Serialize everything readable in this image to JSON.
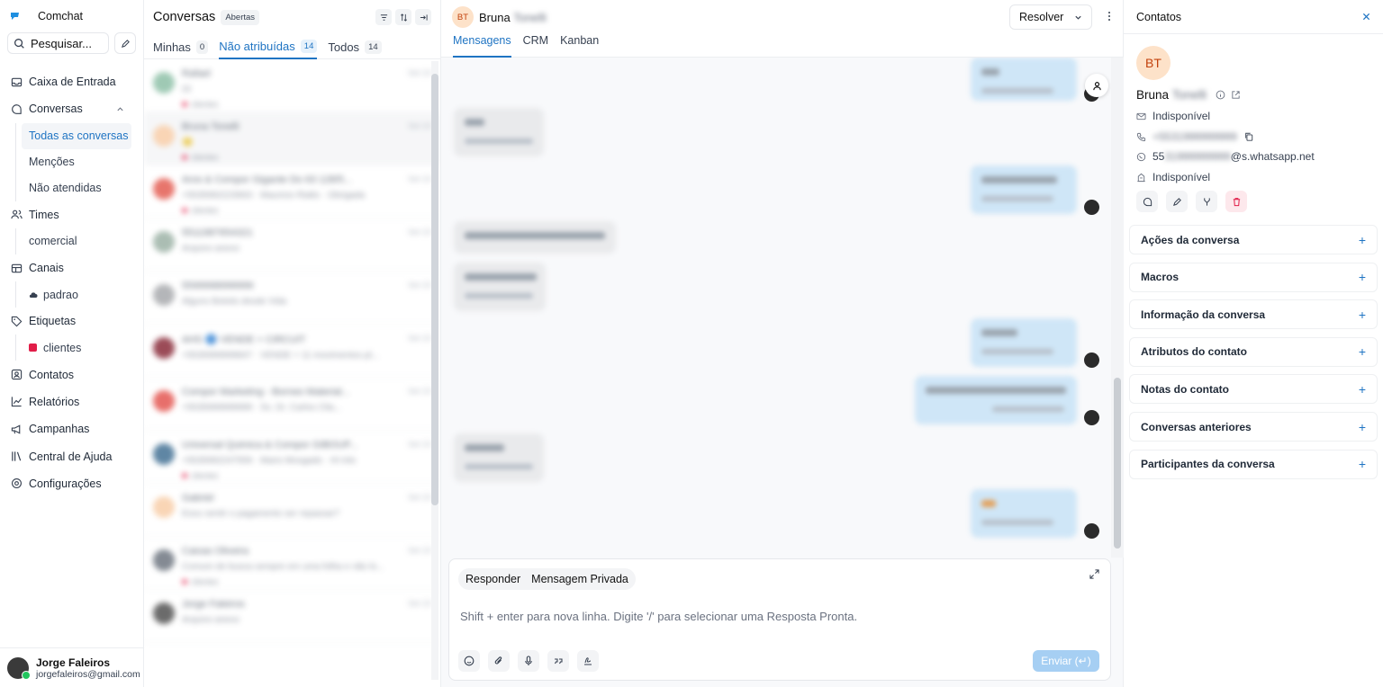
{
  "app": {
    "name": "Comchat"
  },
  "sidebar": {
    "search_label": "Pesquisar...",
    "items": [
      {
        "label": "Caixa de Entrada",
        "icon": "inbox-icon"
      },
      {
        "label": "Conversas",
        "icon": "chat-icon"
      },
      {
        "label": "Times",
        "icon": "users-icon"
      },
      {
        "label": "Canais",
        "icon": "channels-icon"
      },
      {
        "label": "Etiquetas",
        "icon": "tag-icon"
      },
      {
        "label": "Contatos",
        "icon": "contact-icon"
      },
      {
        "label": "Relatórios",
        "icon": "chart-icon"
      },
      {
        "label": "Campanhas",
        "icon": "megaphone-icon"
      },
      {
        "label": "Central de Ajuda",
        "icon": "library-icon"
      },
      {
        "label": "Configurações",
        "icon": "settings-icon"
      }
    ],
    "conversas_sub": [
      "Todas as conversas",
      "Menções",
      "Não atendidas"
    ],
    "times_sub": [
      "comercial"
    ],
    "canais_sub": [
      "padrao"
    ],
    "etiquetas_sub": [
      "clientes"
    ],
    "user": {
      "name": "Jorge Faleiros",
      "email": "jorgefaleiros@gmail.com"
    }
  },
  "conversations": {
    "title": "Conversas",
    "status_badge": "Abertas",
    "tabs": [
      {
        "label": "Minhas",
        "count": "0"
      },
      {
        "label": "Não atribuídas",
        "count": "14"
      },
      {
        "label": "Todos",
        "count": "14"
      }
    ],
    "items": [
      {
        "name": "Rafael",
        "preview": "Oi",
        "time": "Set 10",
        "label": "clientes",
        "color": "#7fb89c"
      },
      {
        "name": "Bruna Tonelli",
        "preview": "🙂",
        "time": "Set 10",
        "label": "clientes",
        "color": "#f7c79d"
      },
      {
        "name": "Aros & Compor Gigante Do 63 128/5...",
        "preview": "+5535992223663 · Mauricio Rialto · Obrigada",
        "time": "Set 10",
        "label": "clientes",
        "color": "#e0483c"
      },
      {
        "name": "5511987654321",
        "preview": "Arquivo anexo",
        "time": "Set 10",
        "label": "",
        "color": "#8fa89a"
      },
      {
        "name": "5599998999999",
        "preview": "Alguns Bolotis desde Vida",
        "time": "Set 10",
        "label": "",
        "color": "#9c9ea2"
      },
      {
        "name": "AHS 🔵 VENDE + CIRCUIT",
        "preview": "+5535999999847 · VENDE + 11 movimentos pl...",
        "time": "Set 10",
        "label": "",
        "color": "#7a1020"
      },
      {
        "name": "Compor Marketing - Bornes Material...",
        "preview": "+5535999999999 · Ss. Dr. Carlos Clia...",
        "time": "Set 10",
        "label": "",
        "color": "#e0403a"
      },
      {
        "name": "Universal Quimica & Compor GIBOUP...",
        "preview": "+5535992247559 · Mario Mosgado · Hi Inlo",
        "time": "Set 10",
        "label": "clientes",
        "color": "#2a5e86"
      },
      {
        "name": "Gabriel",
        "preview": "Esou sentir o pagamento ser repassar?",
        "time": "Set 10",
        "label": "",
        "color": "#f7c79d"
      },
      {
        "name": "Caixas Oliveira",
        "preview": "Comum de busca sempre em uma folha e não lo...",
        "time": "Set 10",
        "label": "clientes",
        "color": "#5b6470"
      },
      {
        "name": "Jorge Faleiros",
        "preview": "Arquivo anexo",
        "time": "Set 10",
        "label": "",
        "color": "#3a3a3a"
      }
    ]
  },
  "chat": {
    "initials": "BT",
    "contact_first": "Bruna",
    "contact_last": "Tonelli",
    "resolve_label": "Resolver",
    "tabs": [
      "Mensagens",
      "CRM",
      "Kanban"
    ],
    "reply_tabs": [
      "Responder",
      "Mensagem Privada"
    ],
    "placeholder": "Shift + enter para nova linha. Digite '/' para selecionar uma Resposta Pronta.",
    "send_label": "Enviar (↵)"
  },
  "contact_panel": {
    "title": "Contatos",
    "initials": "BT",
    "first_name": "Bruna",
    "last_name": "Tonelli",
    "email": "Indisponível",
    "phone": "+5531999999999",
    "whatsapp_prefix": "55",
    "whatsapp_hidden": "31999999999",
    "whatsapp_suffix": "@s.whatsapp.net",
    "company": "Indisponível",
    "accordions": [
      "Ações da conversa",
      "Macros",
      "Informação da conversa",
      "Atributos do contato",
      "Notas do contato",
      "Conversas anteriores",
      "Participantes da conversa"
    ]
  },
  "colors": {
    "accent": "#1f74c3",
    "out_bubble": "#cfe6f7",
    "in_bubble": "#e9eaec",
    "label_red": "#e11d48"
  }
}
